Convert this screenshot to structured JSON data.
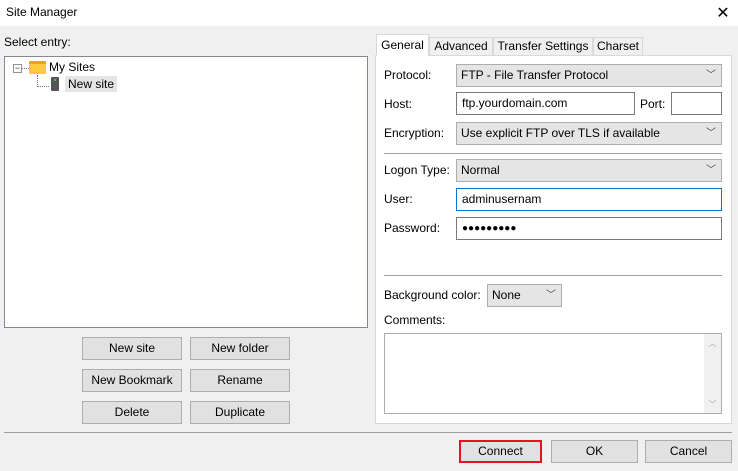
{
  "window": {
    "title": "Site Manager",
    "close": "✕"
  },
  "left": {
    "select_label": "Select entry:",
    "tree": {
      "root": "My Sites",
      "child": "New site"
    },
    "buttons": {
      "new_site": "New site",
      "new_folder": "New folder",
      "new_bookmark": "New Bookmark",
      "rename": "Rename",
      "delete": "Delete",
      "duplicate": "Duplicate"
    }
  },
  "tabs": [
    "General",
    "Advanced",
    "Transfer Settings",
    "Charset"
  ],
  "general": {
    "protocol_label": "Protocol:",
    "protocol": "FTP - File Transfer Protocol",
    "host_label": "Host:",
    "host": "ftp.yourdomain.com",
    "port_label": "Port:",
    "port": "",
    "encryption_label": "Encryption:",
    "encryption": "Use explicit FTP over TLS if available",
    "logon_label": "Logon Type:",
    "logon": "Normal",
    "user_label": "User:",
    "user": "adminusernam",
    "password_label": "Password:",
    "password": "●●●●●●●●●",
    "bg_label": "Background color:",
    "bg": "None",
    "comments_label": "Comments:"
  },
  "footer": {
    "connect": "Connect",
    "ok": "OK",
    "cancel": "Cancel"
  },
  "colors": {
    "highlight": "#e81123",
    "focus": "#0078d7"
  }
}
